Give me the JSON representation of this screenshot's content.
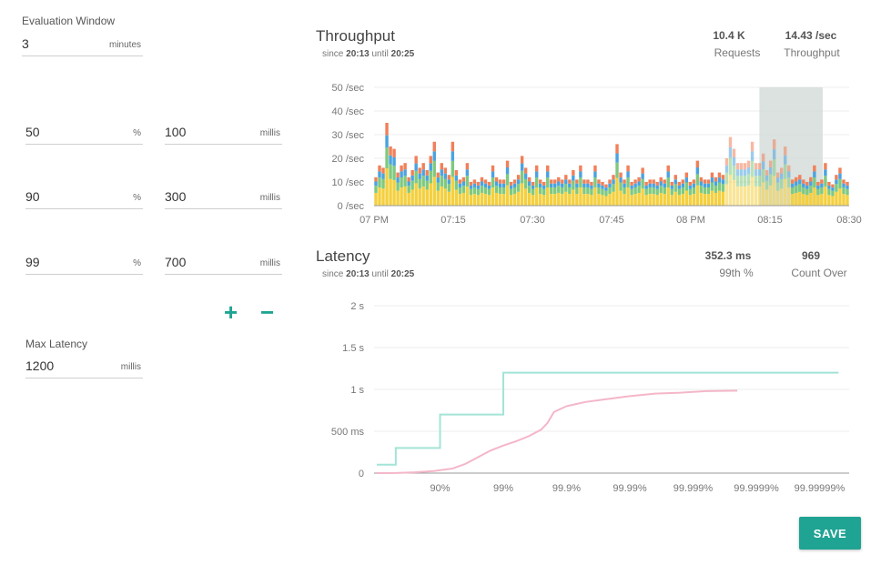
{
  "eval_window": {
    "label": "Evaluation Window",
    "value": "3",
    "unit": "minutes"
  },
  "percentile_rows": [
    {
      "percentile": "50",
      "pct_unit": "%",
      "latency": "100",
      "lat_unit": "millis"
    },
    {
      "percentile": "90",
      "pct_unit": "%",
      "latency": "300",
      "lat_unit": "millis"
    },
    {
      "percentile": "99",
      "pct_unit": "%",
      "latency": "700",
      "lat_unit": "millis"
    }
  ],
  "controls": {
    "add_icon": "plus-icon",
    "remove_icon": "minus-icon",
    "add_glyph": "+",
    "remove_glyph": "−"
  },
  "max_latency": {
    "label": "Max Latency",
    "value": "1200",
    "unit": "millis"
  },
  "throughput": {
    "title": "Throughput",
    "since_prefix": "since",
    "since": "20:13",
    "until_prefix": "until",
    "until": "20:25",
    "stats": [
      {
        "value": "10.4 K",
        "label": "Requests"
      },
      {
        "value": "14.43 /sec",
        "label": "Throughput"
      }
    ]
  },
  "latency": {
    "title": "Latency",
    "since_prefix": "since",
    "since": "20:13",
    "until_prefix": "until",
    "until": "20:25",
    "stats": [
      {
        "value": "352.3 ms",
        "label": "99th %"
      },
      {
        "value": "969",
        "label": "Count Over"
      }
    ]
  },
  "save_label": "SAVE",
  "colors": {
    "accent": "#1fa393",
    "stack": [
      "#f4d03f",
      "#7fc97f",
      "#4aa3df",
      "#f0805a"
    ],
    "highlight": "#cfd8d6",
    "threshold_line": "#a3e4d7",
    "latency_line": "#f4b6c8"
  },
  "chart_data": [
    {
      "type": "bar",
      "stacked": true,
      "title": "Throughput",
      "x_ticks": [
        "07 PM",
        "07:15",
        "07:30",
        "07:45",
        "08 PM",
        "08:15",
        "08:30"
      ],
      "y_ticks": [
        "0 /sec",
        "10 /sec",
        "20 /sec",
        "30 /sec",
        "40 /sec",
        "50 /sec"
      ],
      "ylim": [
        0,
        50
      ],
      "highlight_range": [
        "20:13",
        "20:25"
      ],
      "totals": [
        12,
        17,
        16,
        35,
        25,
        24,
        14,
        17,
        18,
        12,
        15,
        21,
        16,
        18,
        15,
        21,
        27,
        14,
        18,
        16,
        13,
        27,
        15,
        11,
        12,
        18,
        10,
        11,
        10,
        12,
        11,
        10,
        17,
        12,
        11,
        11,
        19,
        10,
        11,
        13,
        21,
        16,
        12,
        10,
        17,
        11,
        10,
        17,
        11,
        11,
        12,
        11,
        13,
        11,
        15,
        11,
        17,
        11,
        11,
        10,
        17,
        11,
        10,
        9,
        11,
        13,
        26,
        14,
        11,
        17,
        10,
        11,
        12,
        16,
        10,
        11,
        11,
        10,
        12,
        11,
        17,
        10,
        13,
        10,
        11,
        14,
        10,
        11,
        19,
        12,
        11,
        11,
        14,
        12,
        14,
        13,
        20,
        29,
        24,
        18,
        18,
        18,
        19,
        27,
        18,
        18,
        22,
        15,
        19,
        28,
        14,
        16,
        25,
        17,
        11,
        12,
        13,
        11,
        10,
        12,
        17,
        10,
        11,
        18,
        10,
        9,
        13,
        16,
        11,
        10
      ]
    },
    {
      "type": "line",
      "title": "Latency",
      "x_ticks": [
        "90%",
        "99%",
        "99.9%",
        "99.99%",
        "99.999%",
        "99.9999%",
        "99.99999%"
      ],
      "y_ticks": [
        "0",
        "500 ms",
        "1 s",
        "1.5 s",
        "2 s"
      ],
      "ylim": [
        0,
        2000
      ],
      "series": [
        {
          "x": [
            0,
            0.3,
            0.3,
            1,
            1,
            2,
            2,
            7.3
          ],
          "y": [
            100,
            100,
            300,
            300,
            700,
            700,
            1200,
            1200
          ]
        },
        {
          "x": [
            0,
            0.3,
            0.6,
            0.9,
            1.2,
            1.4,
            1.6,
            1.8,
            2.0,
            2.2,
            2.4,
            2.6,
            2.7,
            2.8,
            3.0,
            3.3,
            3.6,
            4.0,
            4.4,
            4.8,
            5.2,
            5.7
          ],
          "y": [
            0,
            2,
            10,
            25,
            55,
            110,
            190,
            270,
            330,
            380,
            440,
            520,
            600,
            730,
            800,
            850,
            880,
            920,
            950,
            960,
            980,
            985
          ]
        }
      ]
    }
  ]
}
